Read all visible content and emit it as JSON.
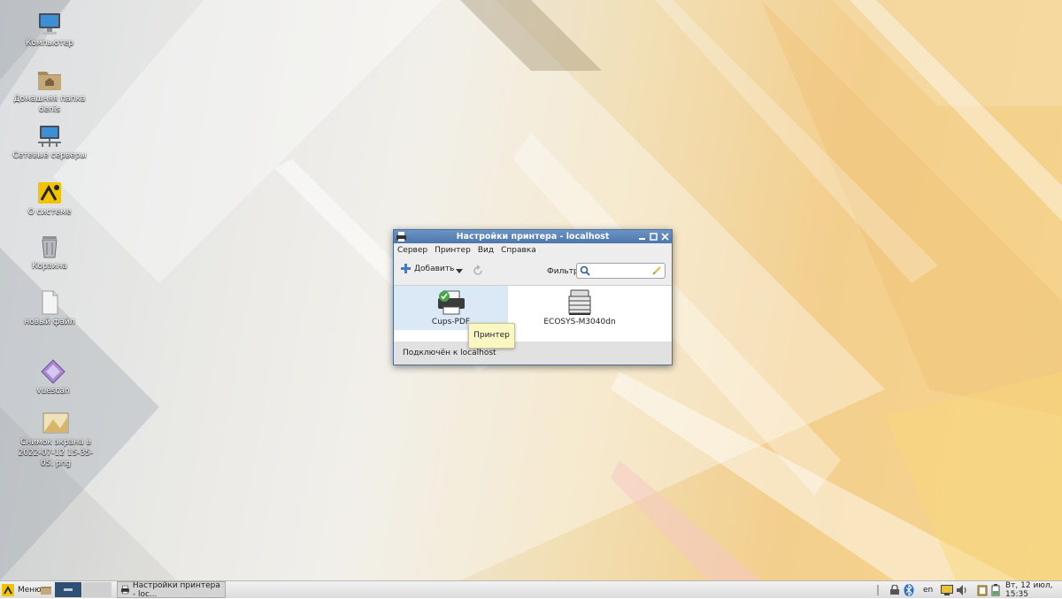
{
  "desktop": {
    "icons": [
      {
        "label": "Компьютер",
        "icon": "computer-icon"
      },
      {
        "label": "Домашняя папка denis",
        "icon": "home-folder-icon"
      },
      {
        "label": "Сетевые серверы",
        "icon": "network-servers-icon"
      },
      {
        "label": "О системе",
        "icon": "basealt-logo-icon"
      },
      {
        "label": "Корзина",
        "icon": "trash-icon"
      },
      {
        "label": "новый файл",
        "icon": "file-icon"
      },
      {
        "label": "vuescan",
        "icon": "vuescan-icon"
      },
      {
        "label": "Снимок экрана в 2022-07-12 15-35-05. png",
        "icon": "image-file-icon"
      }
    ]
  },
  "window": {
    "title": "Настройки принтера - localhost",
    "menu": [
      "Сервер",
      "Принтер",
      "Вид",
      "Справка"
    ],
    "toolbar": {
      "add_label": "Добавить",
      "filter_label": "Фильтр:",
      "filter_value": ""
    },
    "printers": [
      {
        "name": "Cups-PDF",
        "selected": true
      },
      {
        "name": "ECOSYS-M3040dn",
        "selected": false
      }
    ],
    "tooltip": "Принтер",
    "status": "Подключён к localhost"
  },
  "panel": {
    "menu_label": "Меню",
    "task_label": "Настройки принтера - loc...",
    "tray": {
      "keyboard_layout": "en",
      "datetime": "Вт, 12 июл, 15:35"
    }
  },
  "colors": {
    "titlebar": "#5a83b9",
    "selection": "#dbe9f7",
    "tooltip": "#fbf7c2"
  }
}
